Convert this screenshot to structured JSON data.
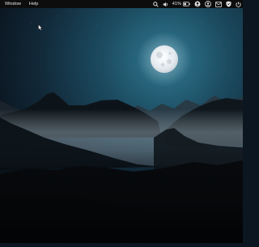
{
  "menubar": {
    "items": [
      {
        "label": "Window"
      },
      {
        "label": "Help"
      }
    ],
    "status": {
      "battery_percent": "41%",
      "icons": [
        "search-icon",
        "volume-icon",
        "battery-icon",
        "account-icon",
        "profile-icon",
        "mail-icon",
        "shield-icon",
        "power-icon"
      ]
    }
  },
  "desktop": {
    "wallpaper": "night-mountains-full-moon",
    "colors": {
      "sky_top": "#0c1722",
      "sky_glow": "#2d6f86",
      "moon": "#e9eef2",
      "mist": "#9aa7b0",
      "mountain_dark": "#05080b"
    }
  }
}
